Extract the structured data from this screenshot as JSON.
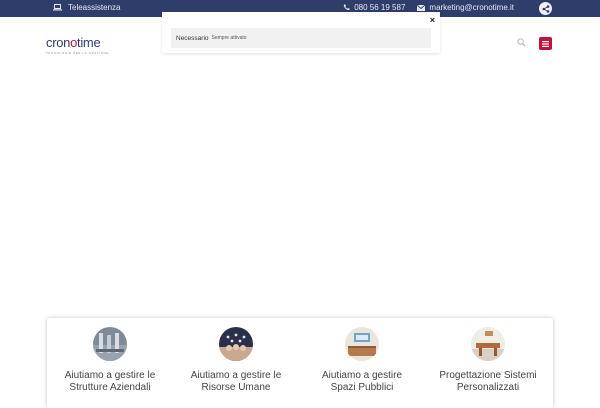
{
  "topbar": {
    "teleassistenza": "Teleassistenza",
    "phone": "080 56 19 587",
    "email": "marketing@cronotime.it",
    "icons": {
      "laptop": "laptop-icon",
      "phone": "phone-icon",
      "mail": "envelope-icon",
      "share": "share-icon"
    }
  },
  "header": {
    "logo_part1": "cron",
    "logo_o": "o",
    "logo_part2": "time",
    "logo_tagline": "TECNOLOGIE PER LA GESTIONE"
  },
  "popup": {
    "close_label": "×",
    "category": "Necessario",
    "status": "Sempre attivato"
  },
  "services": [
    {
      "line1": "Aiutiamo a gestire le",
      "line2": "Strutture Aziendali"
    },
    {
      "line1": "Aiutiamo a gestire le",
      "line2": "Risorse Umane"
    },
    {
      "line1": "Aiutiamo a gestire",
      "line2": "Spazi Pubblici"
    },
    {
      "line1": "Progettazione Sistemi",
      "line2": "Personalizzati"
    }
  ],
  "colors": {
    "topbar": "#2f3d6b",
    "accent": "#c0143c"
  }
}
